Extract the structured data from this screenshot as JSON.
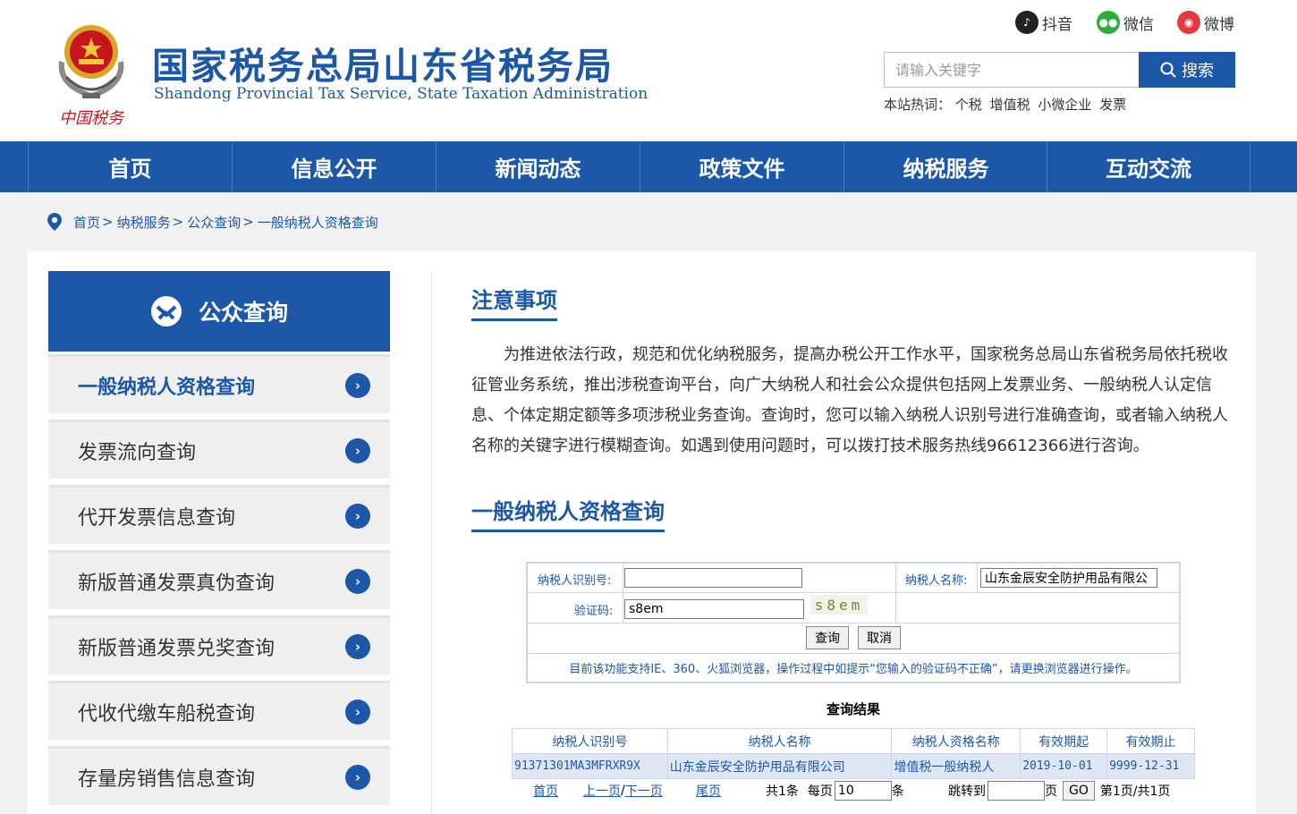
{
  "header": {
    "title": "国家税务总局山东省税务局",
    "subtitle": "Shandong Provincial Tax Service, State Taxation Administration",
    "emblem_caption": "中国税务",
    "social": [
      {
        "label": "抖音",
        "icon": "douyin-icon",
        "color": "#222222"
      },
      {
        "label": "微信",
        "icon": "wechat-icon",
        "color": "#2aae37"
      },
      {
        "label": "微博",
        "icon": "weibo-icon",
        "color": "#e6393e"
      }
    ],
    "search": {
      "placeholder": "请输入关键字",
      "button_label": "搜索"
    },
    "hot": {
      "label": "本站热词：",
      "words": [
        "个税",
        "增值税",
        "小微企业",
        "发票"
      ]
    }
  },
  "nav": [
    "首页",
    "信息公开",
    "新闻动态",
    "政策文件",
    "纳税服务",
    "互动交流"
  ],
  "breadcrumb": [
    "首页",
    "纳税服务",
    "公众查询",
    "一般纳税人资格查询"
  ],
  "sidebar": {
    "title": "公众查询",
    "items": [
      "一般纳税人资格查询",
      "发票流向查询",
      "代开发票信息查询",
      "新版普通发票真伪查询",
      "新版普通发票兑奖查询",
      "代收代缴车船税查询",
      "存量房销售信息查询"
    ],
    "active_index": 0
  },
  "notice": {
    "title": "注意事项",
    "text": "为推进依法行政，规范和优化纳税服务，提高办税公开工作水平，国家税务总局山东省税务局依托税收征管业务系统，推出涉税查询平台，向广大纳税人和社会公众提供包括网上发票业务、一般纳税人认定信息、个体定期定额等多项涉税业务查询。查询时，您可以输入纳税人识别号进行准确查询，或者输入纳税人名称的关键字进行模糊查询。如遇到使用问题时，可以拨打技术服务热线96612366进行咨询。"
  },
  "query": {
    "title": "一般纳税人资格查询",
    "taxid_label": "纳税人识别号:",
    "taxid_value": "",
    "name_label": "纳税人名称:",
    "name_value": "山东金辰安全防护用品有限公",
    "captcha_label": "验证码:",
    "captcha_value": "s8em",
    "captcha_image": "s8em",
    "submit_label": "查询",
    "cancel_label": "取消",
    "tip": "目前该功能支持IE、360、火狐浏览器，操作过程中如提示“您输入的验证码不正确”，请更换浏览器进行操作。"
  },
  "results": {
    "title": "查询结果",
    "columns": [
      "纳税人识别号",
      "纳税人名称",
      "纳税人资格名称",
      "有效期起",
      "有效期止"
    ],
    "rows": [
      [
        "91371301MA3MFRXR9X",
        "山东金辰安全防护用品有限公司",
        "增值税一般纳税人",
        "2019-10-01",
        "9999-12-31"
      ]
    ]
  },
  "pager": {
    "first": "首页",
    "prev": "上一页",
    "slash": "/",
    "next": "下一页",
    "last": "尾页",
    "total": "共1条",
    "per_page_label": "每页",
    "per_page_value": "10",
    "per_page_unit": "条",
    "jump_label": "跳转到",
    "jump_value": "",
    "jump_unit": "页",
    "go_label": "GO",
    "status": "第1页/共1页"
  }
}
